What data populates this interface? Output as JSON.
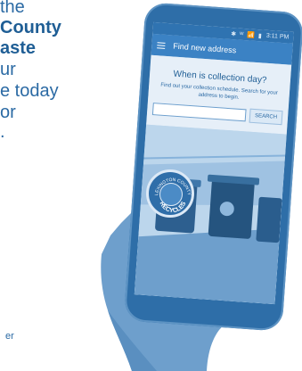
{
  "promo": {
    "lines": [
      {
        "text": "the",
        "style": "reg"
      },
      {
        "text": "County",
        "style": "bold"
      },
      {
        "text": "aste",
        "style": "bold"
      },
      {
        "text": "ur",
        "style": "reg"
      },
      {
        "text": "e today",
        "style": "reg"
      },
      {
        "text": "or",
        "style": "reg"
      },
      {
        "text": ".",
        "style": "reg"
      },
      {
        "text": "er",
        "style": "small"
      }
    ]
  },
  "phone": {
    "statusbar": {
      "icons": "✱ ᵂ 📶 ▮",
      "time": "3:11 PM"
    },
    "appbar": {
      "title": "Find new address"
    },
    "content": {
      "heading": "When is collection day?",
      "subtext": "Find out your collection schedule. Search for your address to begin.",
      "search": {
        "placeholder": "",
        "button_label": "SEARCH"
      }
    },
    "badge": {
      "top_text": "LEXINGTON COUNTY",
      "bottom_text": "RECYCLES"
    }
  },
  "colors": {
    "brand_blue": "#2f73b1",
    "appbar_blue": "#3b82c4",
    "text_blue": "#1f5e95"
  }
}
